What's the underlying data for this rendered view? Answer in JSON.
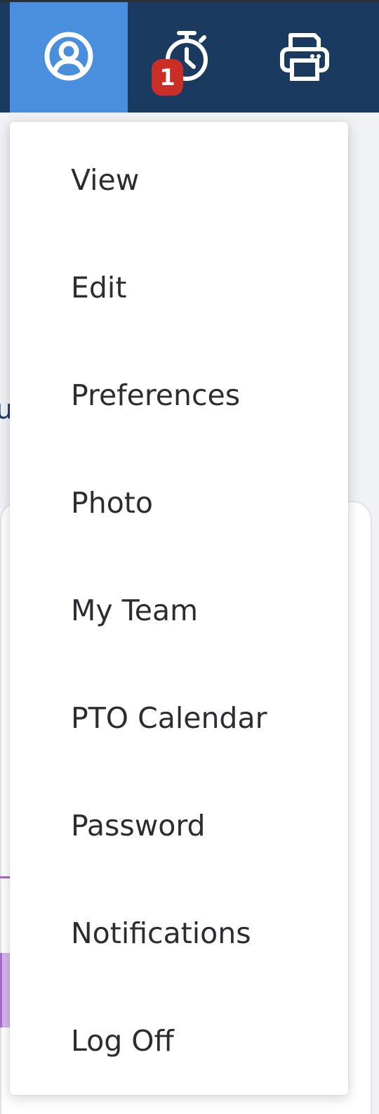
{
  "topbar": {
    "buttons": [
      {
        "icon": "user-circle-icon",
        "active": true
      },
      {
        "icon": "stopwatch-icon",
        "badge": "1"
      },
      {
        "icon": "printer-icon"
      }
    ]
  },
  "menu": {
    "items": [
      {
        "label": "View"
      },
      {
        "label": "Edit"
      },
      {
        "label": "Preferences"
      },
      {
        "label": "Photo"
      },
      {
        "label": "My Team"
      },
      {
        "label": "PTO Calendar"
      },
      {
        "label": "Password"
      },
      {
        "label": "Notifications"
      },
      {
        "label": "Log Off"
      }
    ]
  },
  "background": {
    "partial_text": "u"
  },
  "colors": {
    "topbar": "#1a3a60",
    "active_button": "#4a8fdd",
    "badge": "#c92f27",
    "menu_text": "#2b2d31"
  }
}
